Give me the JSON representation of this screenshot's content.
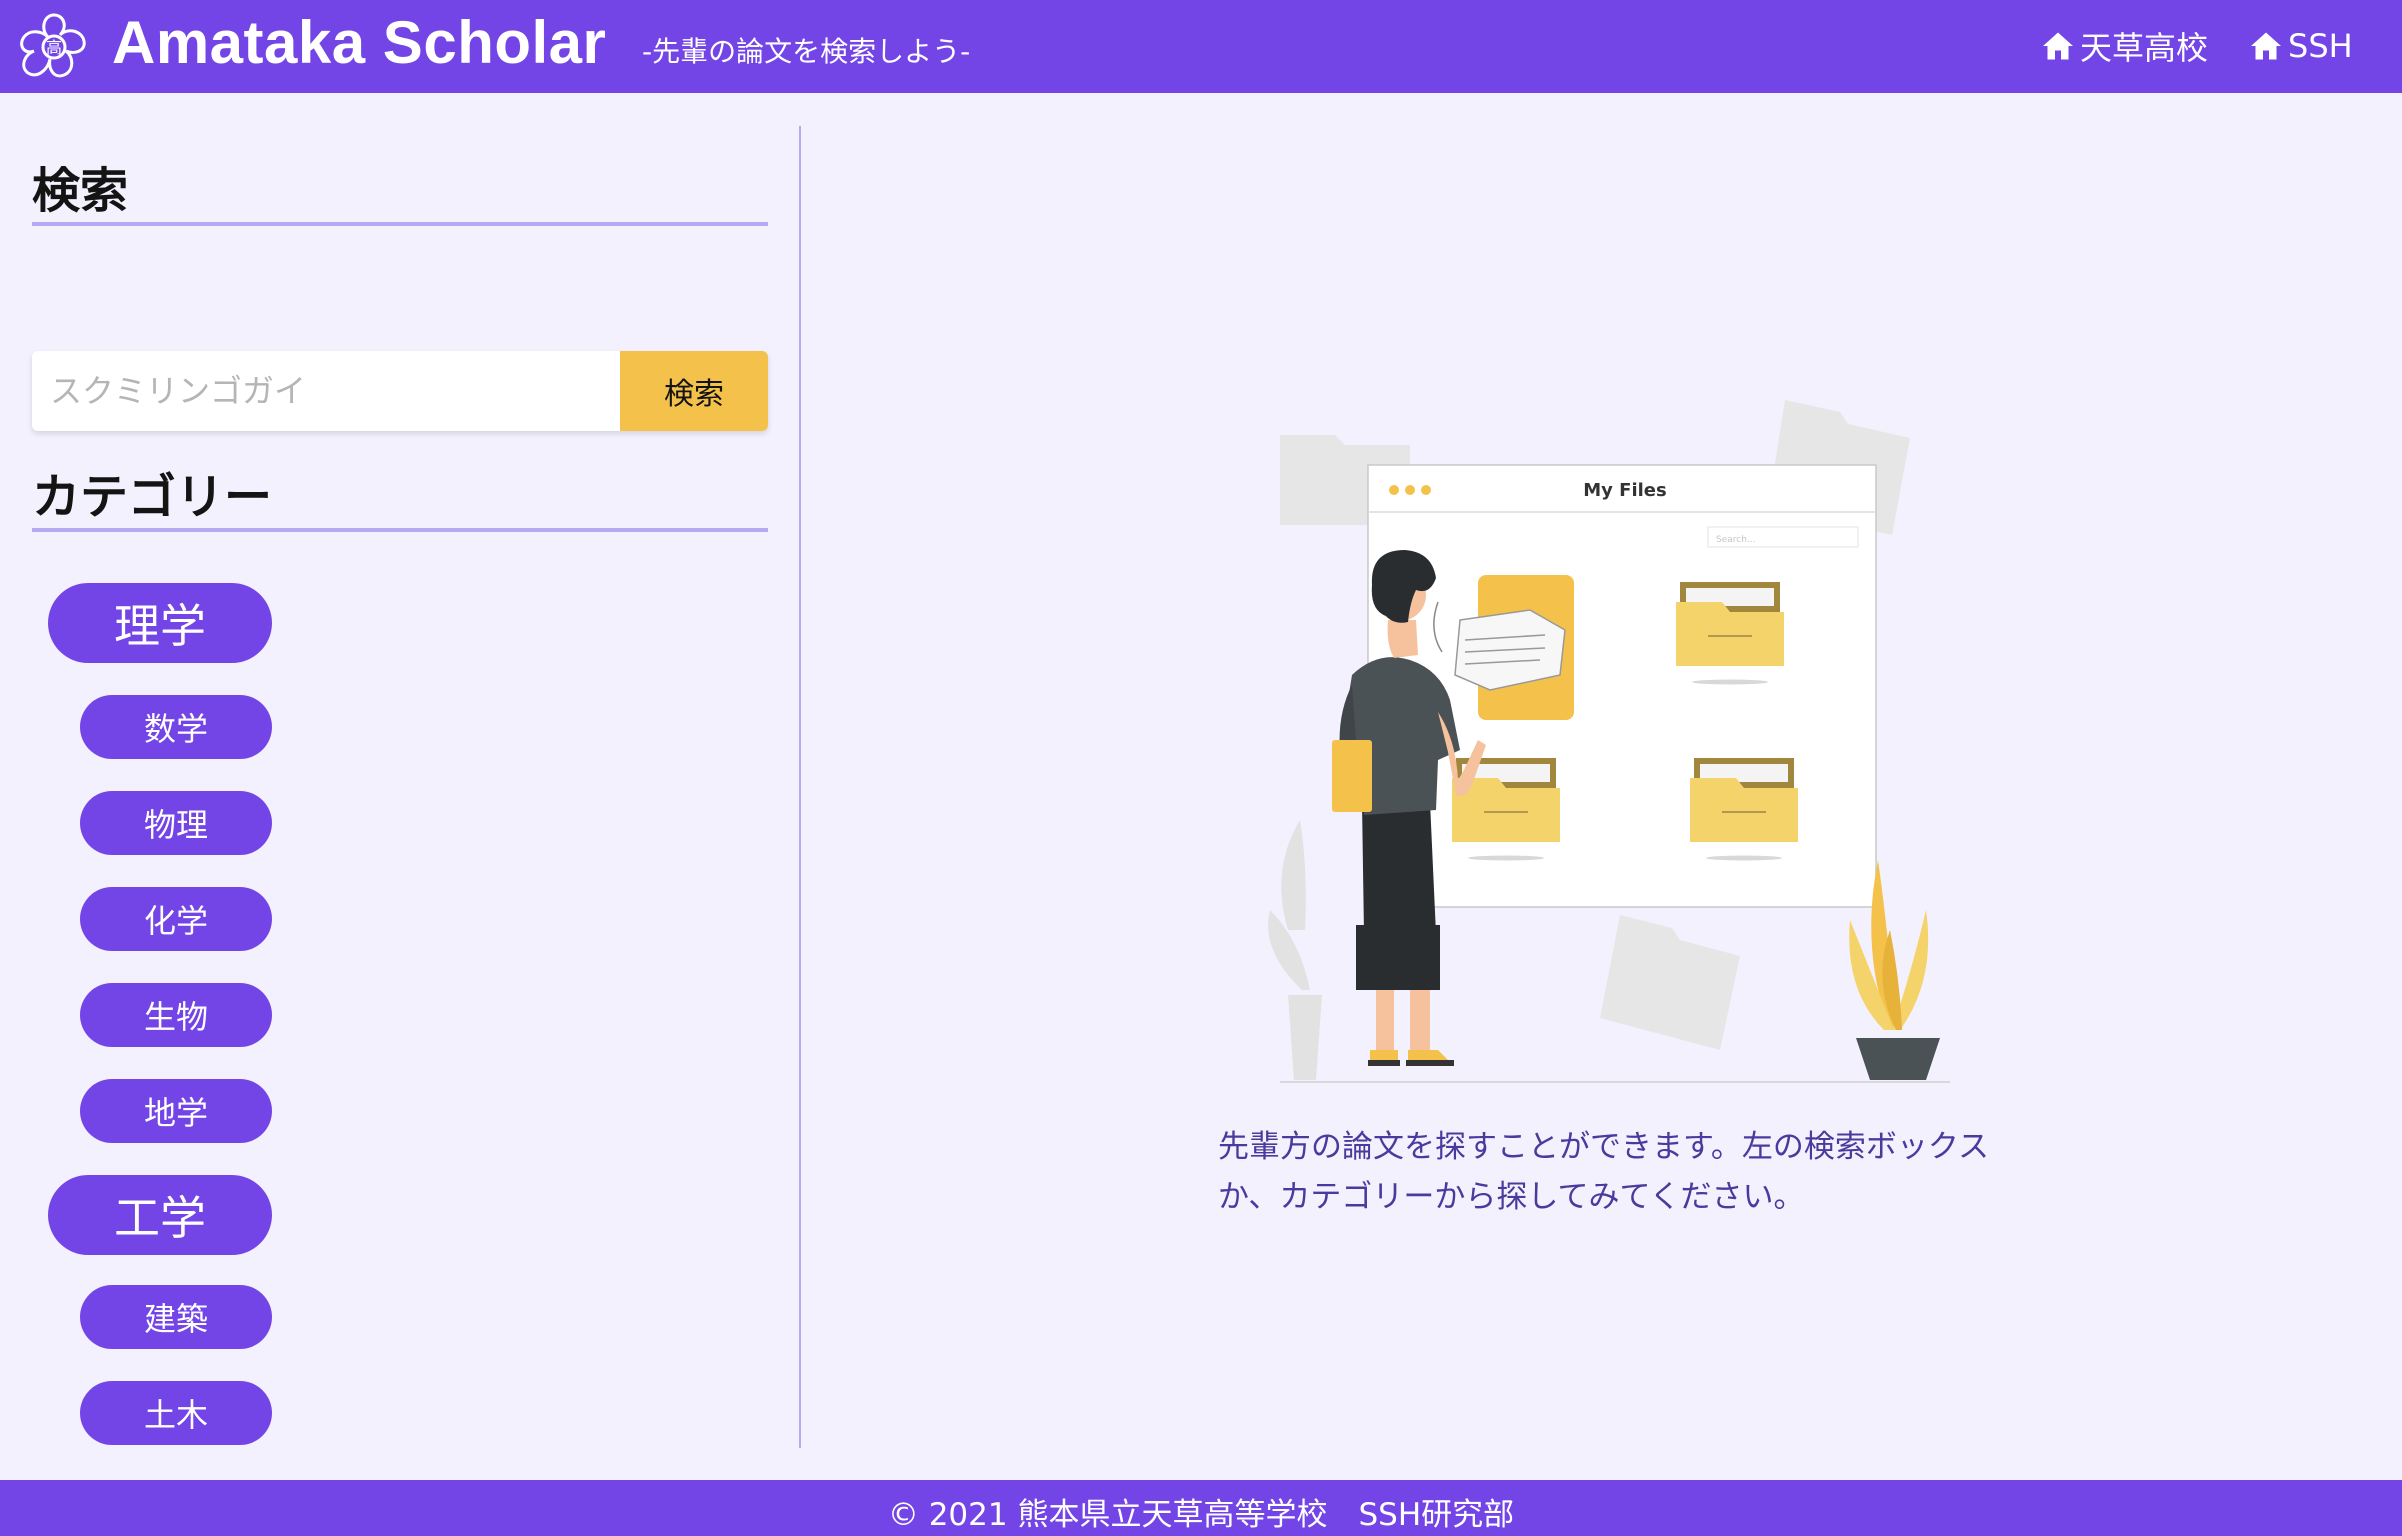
{
  "header": {
    "brand": "Amataka Scholar",
    "tagline": "-先輩の論文を検索しよう-",
    "links": [
      {
        "label": "天草高校",
        "icon": "home-icon"
      },
      {
        "label": "SSH",
        "icon": "home-icon"
      }
    ]
  },
  "sidebar": {
    "search_title": "検索",
    "search_placeholder": "スクミリンゴガイ",
    "search_button": "検索",
    "category_title": "カテゴリー",
    "categories": [
      {
        "label": "理学",
        "level": "main"
      },
      {
        "label": "数学",
        "level": "sub"
      },
      {
        "label": "物理",
        "level": "sub"
      },
      {
        "label": "化学",
        "level": "sub"
      },
      {
        "label": "生物",
        "level": "sub"
      },
      {
        "label": "地学",
        "level": "sub"
      },
      {
        "label": "工学",
        "level": "main"
      },
      {
        "label": "建築",
        "level": "sub"
      },
      {
        "label": "土木",
        "level": "sub"
      }
    ]
  },
  "main": {
    "illustration": {
      "window_title": "My  Files",
      "search_hint": "Search..."
    },
    "description": "先輩方の論文を探すことができます。左の検索ボックスか、カテゴリーから探してみてください。"
  },
  "footer": {
    "text": "© 2021 熊本県立天草高等学校　SSH研究部"
  },
  "colors": {
    "primary": "#7445e6",
    "accent": "#f4c24b",
    "background": "#f3f1fd",
    "rule": "#b4a9f3"
  }
}
